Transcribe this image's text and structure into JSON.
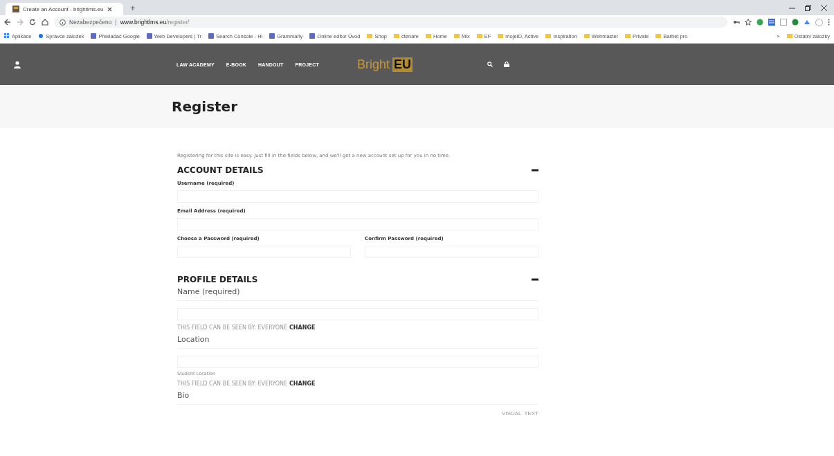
{
  "browser": {
    "tabs": [
      {
        "title": "Create an Account - brightlms.eu",
        "selected": true
      }
    ],
    "new_tab": "+",
    "address": {
      "security": "Nezabezpečeno",
      "separator": "|",
      "host": "www.brightlms.eu",
      "path": "/register/"
    },
    "bookmarks": [
      {
        "label": "Aplikace",
        "kind": "apps"
      },
      {
        "label": "Správce záložek",
        "kind": "dot"
      },
      {
        "label": "Překladač Google",
        "kind": "site"
      },
      {
        "label": "Web Developers | Tr",
        "kind": "site"
      },
      {
        "label": "Search Console - Hl",
        "kind": "site"
      },
      {
        "label": "Grammarly",
        "kind": "site"
      },
      {
        "label": "Online editor Úvod",
        "kind": "site"
      },
      {
        "label": "Shop",
        "kind": "folder"
      },
      {
        "label": "čtenáře",
        "kind": "folder"
      },
      {
        "label": "Home",
        "kind": "folder"
      },
      {
        "label": "Mix",
        "kind": "folder"
      },
      {
        "label": "EF",
        "kind": "folder"
      },
      {
        "label": "mojeID, Active",
        "kind": "folder"
      },
      {
        "label": "Inspiration",
        "kind": "folder"
      },
      {
        "label": "Webmaster",
        "kind": "folder"
      },
      {
        "label": "Private",
        "kind": "folder"
      },
      {
        "label": "Barbet pro",
        "kind": "folder"
      }
    ],
    "more_bookmarks": "»",
    "other_bookmarks": "Ostatní záložky"
  },
  "site": {
    "menu": [
      "LAW ACADEMY",
      "E-BOOK",
      "HANDOUT",
      "PROJECT"
    ],
    "logo": {
      "word": "Bright",
      "mark": "EU"
    }
  },
  "page": {
    "title": "Register",
    "intro": "Registering for this site is easy. Just fill in the fields below, and we'll get a new account set up for you in no time.",
    "sections": [
      {
        "title": "ACCOUNT DETAILS",
        "expanded": true,
        "rows": [
          [
            {
              "kind": "account",
              "label": "Username (required)"
            }
          ],
          [
            {
              "kind": "account",
              "label": "Email Address (required)"
            }
          ],
          [
            {
              "kind": "account",
              "label": "Choose a Password (required)"
            },
            {
              "kind": "account",
              "label": "Confirm Password (required)"
            }
          ]
        ]
      },
      {
        "title": "PROFILE DETAILS",
        "expanded": true,
        "rows": [
          [
            {
              "kind": "profile",
              "label": "Name (required)",
              "visibility": "THIS FIELD CAN BE SEEN BY: EVERYONE",
              "change": "CHANGE"
            }
          ],
          [
            {
              "kind": "profile",
              "label": "Location",
              "description": "Student Location",
              "visibility": "THIS FIELD CAN BE SEEN BY: EVERYONE",
              "change": "CHANGE"
            }
          ],
          [
            {
              "kind": "heading",
              "label": "Bio"
            }
          ]
        ]
      }
    ],
    "editor_tabs": [
      {
        "label": "VISUAL",
        "selected": false
      },
      {
        "label": "TEXT",
        "selected": false
      }
    ]
  }
}
